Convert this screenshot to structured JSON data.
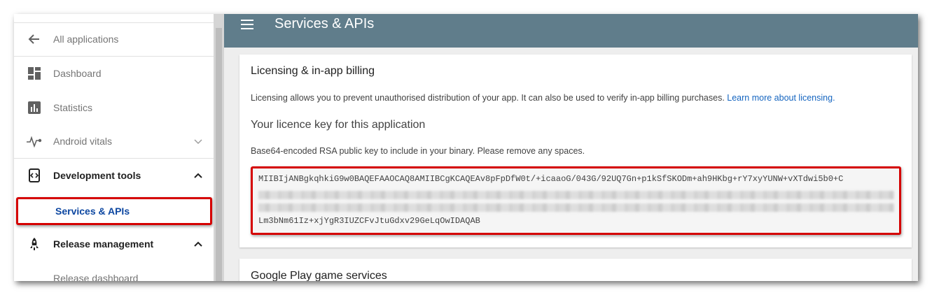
{
  "sidebar": {
    "back_label": "All applications",
    "items": [
      {
        "label": "Dashboard"
      },
      {
        "label": "Statistics"
      },
      {
        "label": "Android vitals"
      },
      {
        "label": "Development tools"
      },
      {
        "label": "Services & APIs"
      },
      {
        "label": "Release management"
      },
      {
        "label": "Release dashboard"
      }
    ]
  },
  "header": {
    "title": "Services & APIs"
  },
  "licensing": {
    "title": "Licensing & in-app billing",
    "description": "Licensing allows you to prevent unauthorised distribution of your app. It can also be used to verify in-app billing purchases.",
    "learn_more": "Learn more about licensing.",
    "key_heading": "Your licence key for this application",
    "key_description": "Base64-encoded RSA public key to include in your binary. Please remove any spaces.",
    "key_line_first": "MIIBIjANBgkqhkiG9w0BAQEFAAOCAQ8AMIIBCgKCAQEAv8pFpDfW0t/+icaaoG/043G/92UQ7Gn+p1kSfSKODm+ah9HKbg+rY7xyYUNW+vXTdwi5b0+C",
    "key_line_last": "Lm3bNm61Iz+xjYgR3IUZCFvJtuGdxv29GeLqOwIDAQAB"
  },
  "games": {
    "title": "Google Play game services"
  },
  "colors": {
    "header": "#607d8b",
    "highlight": "#d50000",
    "link": "#1565c0"
  },
  "icons": [
    "arrow-back-icon",
    "dashboard-icon",
    "statistics-icon",
    "vitals-icon",
    "dev-tools-icon",
    "rocket-icon",
    "hamburger-menu-icon",
    "chevron-down-icon",
    "chevron-up-icon"
  ]
}
